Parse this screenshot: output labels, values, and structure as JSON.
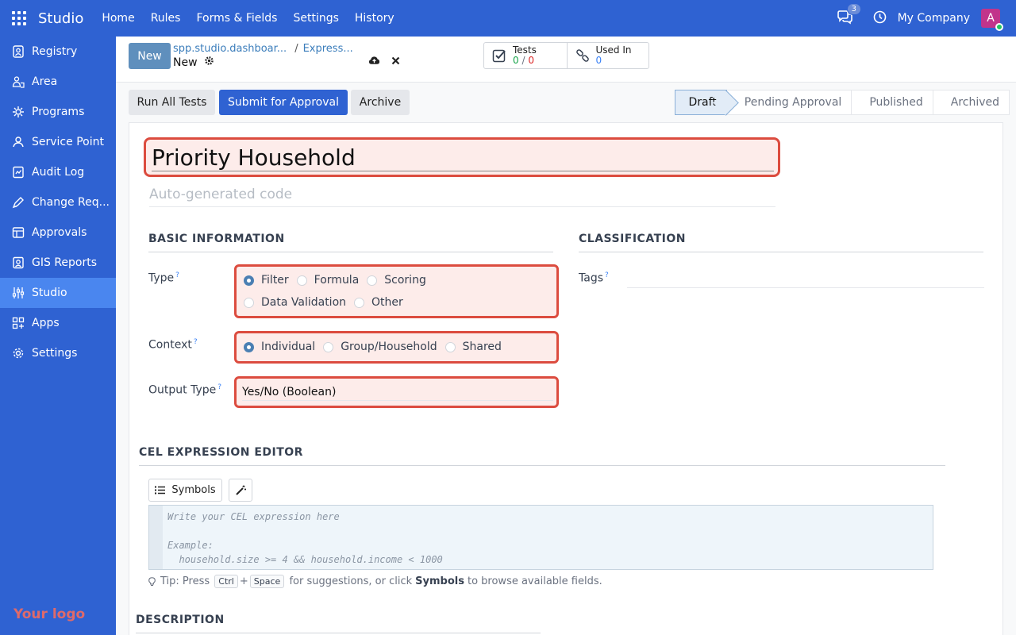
{
  "app": {
    "name": "Studio"
  },
  "topmenu": [
    "Home",
    "Rules",
    "Forms & Fields",
    "Settings",
    "History"
  ],
  "top_right": {
    "chat_count": "3",
    "company": "My Company",
    "avatar_letter": "A"
  },
  "sidebar": {
    "items": [
      {
        "label": "Registry",
        "icon": "registry-icon"
      },
      {
        "label": "Area",
        "icon": "area-icon"
      },
      {
        "label": "Programs",
        "icon": "programs-icon"
      },
      {
        "label": "Service Point",
        "icon": "service-point-icon"
      },
      {
        "label": "Audit Log",
        "icon": "audit-log-icon"
      },
      {
        "label": "Change Req...",
        "icon": "change-request-icon"
      },
      {
        "label": "Approvals",
        "icon": "approvals-icon"
      },
      {
        "label": "GIS Reports",
        "icon": "gis-reports-icon"
      },
      {
        "label": "Studio",
        "icon": "studio-icon",
        "active": true
      },
      {
        "label": "Apps",
        "icon": "apps-icon"
      },
      {
        "label": "Settings",
        "icon": "settings-icon"
      }
    ],
    "logo": "Your logo"
  },
  "control_panel": {
    "new_label": "New",
    "breadcrumb": [
      "spp.studio.dashboar...",
      "Express..."
    ],
    "record_name": "New",
    "stats": [
      {
        "label": "Tests",
        "value_pass": "0",
        "value_sep": " / ",
        "value_fail": "0"
      },
      {
        "label": "Used In",
        "value": "0"
      }
    ]
  },
  "actions": {
    "run_tests": "Run All Tests",
    "submit": "Submit for Approval",
    "archive": "Archive"
  },
  "status_stages": [
    "Draft",
    "Pending Approval",
    "Published",
    "Archived"
  ],
  "status_current": "Draft",
  "form": {
    "name": "Priority Household",
    "code_placeholder": "Auto-generated code",
    "section_basic": "BASIC INFORMATION",
    "section_classification": "CLASSIFICATION",
    "type_label": "Type",
    "type_options": [
      "Filter",
      "Formula",
      "Scoring",
      "Data Validation",
      "Other"
    ],
    "type_selected": "Filter",
    "context_label": "Context",
    "context_options": [
      "Individual",
      "Group/Household",
      "Shared"
    ],
    "context_selected": "Individual",
    "output_label": "Output Type",
    "output_value": "Yes/No (Boolean)",
    "tags_label": "Tags",
    "help_mark": "?",
    "section_cel": "CEL EXPRESSION EDITOR",
    "symbols_label": "Symbols",
    "editor_placeholder": "Write your CEL expression here\n\nExample:\n  household.size >= 4 && household.income < 1000",
    "tip": {
      "prefix": "Tip: Press",
      "key1": "Ctrl",
      "plus": "+",
      "key2": "Space",
      "middle": "for suggestions, or click",
      "bold": "Symbols",
      "suffix": "to browse available fields."
    },
    "section_description": "DESCRIPTION"
  },
  "colors": {
    "brand": "#2f62d2",
    "highlight_border": "#dc4c3f",
    "highlight_fill": "#fdecea"
  }
}
